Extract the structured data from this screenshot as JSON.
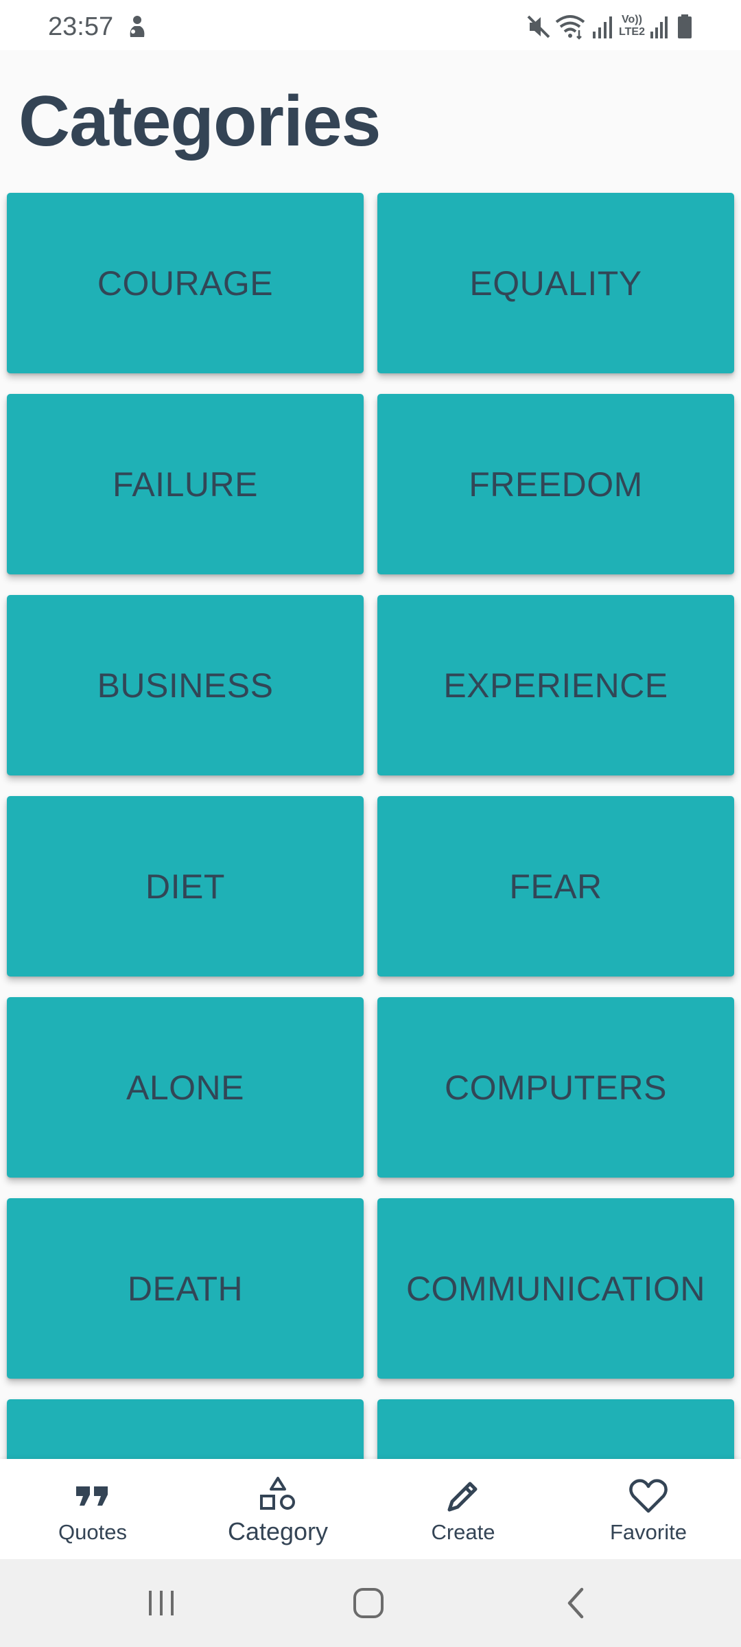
{
  "status_bar": {
    "time": "23:57",
    "icons": [
      "person-notification-icon",
      "mute-icon",
      "wifi-icon",
      "signal-icon",
      "volte-lte2-icon",
      "signal-2-icon",
      "battery-icon"
    ],
    "volte_label_top": "Vo))",
    "volte_label_bottom": "LTE2"
  },
  "header": {
    "title": "Categories"
  },
  "colors": {
    "tile_background": "#1fb1b6",
    "tile_text": "#324656",
    "title_text": "#344455",
    "page_background": "#fafafa"
  },
  "categories": [
    {
      "label": "COURAGE"
    },
    {
      "label": "EQUALITY"
    },
    {
      "label": "FAILURE"
    },
    {
      "label": "FREEDOM"
    },
    {
      "label": "BUSINESS"
    },
    {
      "label": "EXPERIENCE"
    },
    {
      "label": "DIET"
    },
    {
      "label": "FEAR"
    },
    {
      "label": "ALONE"
    },
    {
      "label": "COMPUTERS"
    },
    {
      "label": "DEATH"
    },
    {
      "label": "COMMUNICATION"
    },
    {
      "label": ""
    },
    {
      "label": ""
    }
  ],
  "bottom_nav": {
    "items": [
      {
        "label": "Quotes",
        "icon": "quote-icon",
        "active": false
      },
      {
        "label": "Category",
        "icon": "shapes-icon",
        "active": true
      },
      {
        "label": "Create",
        "icon": "pencil-icon",
        "active": false
      },
      {
        "label": "Favorite",
        "icon": "heart-icon",
        "active": false
      }
    ]
  },
  "system_nav": {
    "buttons": [
      "recent-apps-icon",
      "home-icon",
      "back-icon"
    ]
  }
}
